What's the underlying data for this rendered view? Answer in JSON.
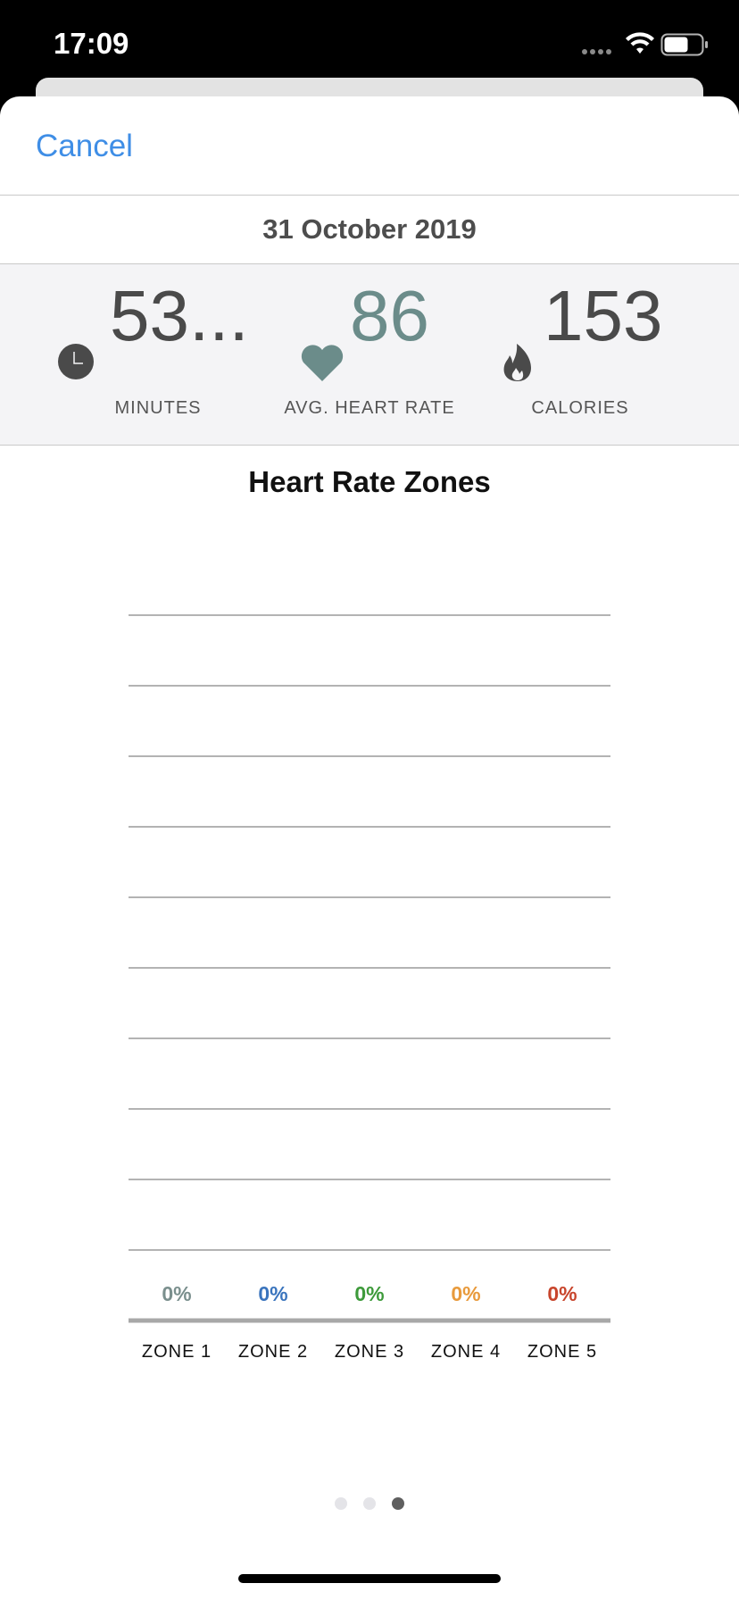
{
  "status_bar": {
    "time": "17:09"
  },
  "header": {
    "cancel_label": "Cancel"
  },
  "date": "31 October 2019",
  "stats": {
    "minutes": {
      "value": "53...",
      "label": "MINUTES",
      "icon": "clock-icon"
    },
    "heart_rate": {
      "value": "86",
      "label": "AVG. HEART RATE",
      "icon": "heart-icon"
    },
    "calories": {
      "value": "153",
      "label": "CALORIES",
      "icon": "flame-icon"
    }
  },
  "chart_data": {
    "type": "bar",
    "title": "Heart Rate Zones",
    "categories": [
      "ZONE 1",
      "ZONE 2",
      "ZONE 3",
      "ZONE 4",
      "ZONE 5"
    ],
    "values": [
      0,
      0,
      0,
      0,
      0
    ],
    "value_labels": [
      "0%",
      "0%",
      "0%",
      "0%",
      "0%"
    ],
    "colors": [
      "#7a8f8d",
      "#3a74bd",
      "#3d9a3a",
      "#e89a3c",
      "#c8452c"
    ],
    "gridlines": 10,
    "grid": true
  },
  "pager": {
    "pages": 3,
    "active": 2
  },
  "colors": {
    "accent": "#3f8ee6",
    "heart": "#6b8c8a",
    "text": "#4a4a4a"
  }
}
